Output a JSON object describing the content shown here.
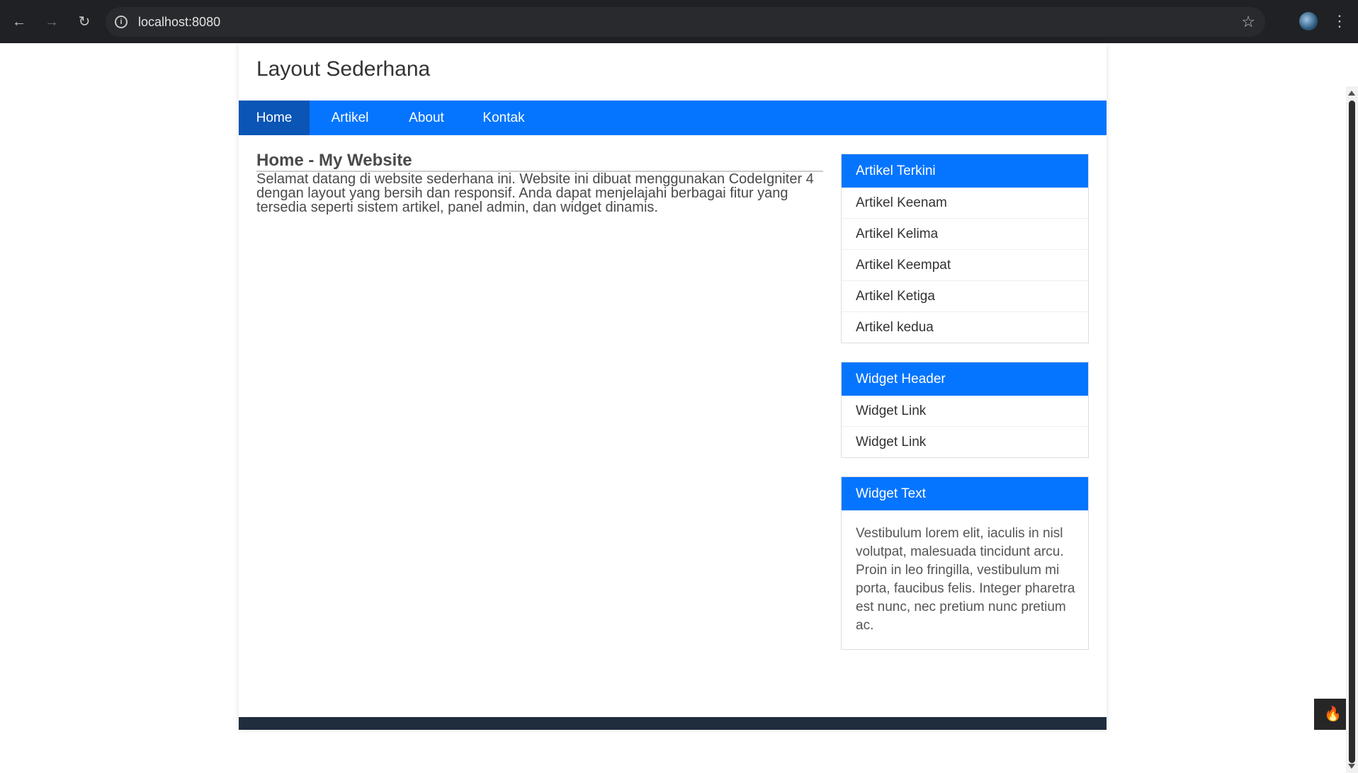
{
  "browser": {
    "url": "localhost:8080"
  },
  "site": {
    "title": "Layout Sederhana"
  },
  "nav": {
    "items": [
      {
        "label": "Home",
        "active": true
      },
      {
        "label": "Artikel",
        "active": false
      },
      {
        "label": "About",
        "active": false
      },
      {
        "label": "Kontak",
        "active": false
      }
    ]
  },
  "content": {
    "title": "Home - My Website",
    "text": "Selamat datang di website sederhana ini. Website ini dibuat menggunakan CodeIgniter 4 dengan layout yang bersih dan responsif. Anda dapat menjelajahi berbagai fitur yang tersedia seperti sistem artikel, panel admin, dan widget dinamis."
  },
  "sidebar": {
    "recent": {
      "header": "Artikel Terkini",
      "items": [
        "Artikel Keenam",
        "Artikel Kelima",
        "Artikel Keempat",
        "Artikel Ketiga",
        "Artikel kedua"
      ]
    },
    "widget_links": {
      "header": "Widget Header",
      "items": [
        "Widget Link",
        "Widget Link"
      ]
    },
    "widget_text": {
      "header": "Widget Text",
      "text": "Vestibulum lorem elit, iaculis in nisl volutpat, malesuada tincidunt arcu. Proin in leo fringilla, vestibulum mi porta, faucibus felis. Integer pharetra est nunc, nec pretium nunc pretium ac."
    }
  },
  "colors": {
    "primary": "#0575ff",
    "nav_active": "#0a55b5",
    "footer": "#1f2d3d",
    "browser_chrome": "#202124"
  },
  "icons": {
    "back": "arrow-left-icon",
    "forward": "arrow-right-icon",
    "reload": "reload-icon",
    "info": "info-icon",
    "bookmark": "star-icon",
    "menu": "more-vertical-icon",
    "debug": "flame-icon"
  }
}
